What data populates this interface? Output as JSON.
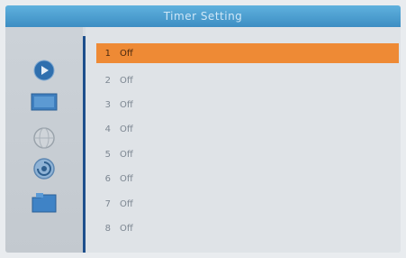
{
  "title": "Timer Setting",
  "sidebar": {
    "icons": [
      "play-icon",
      "picture-icon",
      "globe-icon",
      "settings-icon",
      "folder-icon"
    ]
  },
  "timers": [
    {
      "number": "1",
      "status": "Off",
      "selected": true
    },
    {
      "number": "2",
      "status": "Off"
    },
    {
      "number": "3",
      "status": "Off"
    },
    {
      "number": "4",
      "status": "Off"
    },
    {
      "number": "5",
      "status": "Off"
    },
    {
      "number": "6",
      "status": "Off"
    },
    {
      "number": "7",
      "status": "Off"
    },
    {
      "number": "8",
      "status": "Off"
    }
  ],
  "colors": {
    "title_bar": "#4a9fd2",
    "selection": "#ee8a35",
    "divider": "#1d4f8c"
  }
}
